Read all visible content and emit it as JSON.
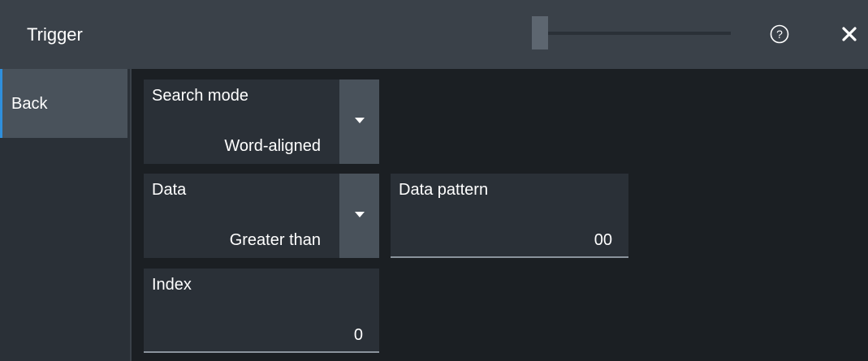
{
  "window": {
    "title": "Trigger",
    "help_icon": "help-circle-icon",
    "close_icon": "close-icon"
  },
  "sidebar": {
    "back_label": "Back"
  },
  "fields": {
    "search_mode": {
      "label": "Search mode",
      "value": "Word-aligned"
    },
    "data": {
      "label": "Data",
      "value": "Greater than"
    },
    "data_pattern": {
      "label": "Data pattern",
      "value": "00"
    },
    "index": {
      "label": "Index",
      "value": "0"
    }
  },
  "colors": {
    "background": "#1b1f23",
    "titlebar": "#3a4149",
    "panel": "#2a3037",
    "button": "#49525b",
    "accent": "#2f8fdc"
  }
}
